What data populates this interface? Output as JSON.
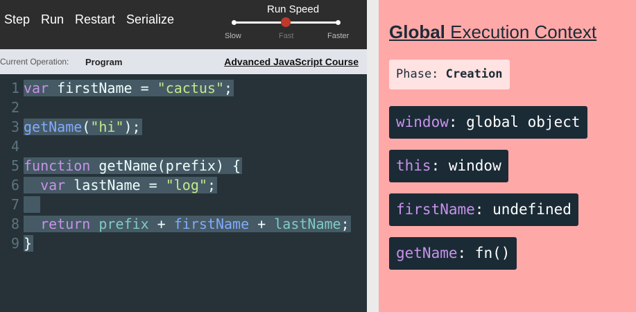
{
  "toolbar": {
    "buttons": [
      "Step",
      "Run",
      "Restart",
      "Serialize"
    ],
    "speed_title": "Run Speed",
    "speed_options": [
      "Slow",
      "Fast",
      "Faster"
    ],
    "speed_selected": "Fast"
  },
  "opbar": {
    "label": "Current Operation:",
    "value": "Program",
    "course_link": "Advanced JavaScript Course"
  },
  "code": {
    "line_numbers": [
      "1",
      "2",
      "3",
      "4",
      "5",
      "6",
      "7",
      "8",
      "9"
    ],
    "lines": [
      [
        {
          "t": "var",
          "c": "kw"
        },
        {
          "t": " firstName = ",
          "c": "plain"
        },
        {
          "t": "\"cactus\"",
          "c": "str"
        },
        {
          "t": ";",
          "c": "plain"
        }
      ],
      [],
      [
        {
          "t": "getName",
          "c": "fn"
        },
        {
          "t": "(",
          "c": "plain"
        },
        {
          "t": "\"hi\"",
          "c": "str"
        },
        {
          "t": ");",
          "c": "plain"
        }
      ],
      [],
      [
        {
          "t": "function",
          "c": "kw"
        },
        {
          "t": " getName(prefix) {",
          "c": "plain"
        }
      ],
      [
        {
          "t": "  ",
          "c": "plain"
        },
        {
          "t": "var",
          "c": "kw"
        },
        {
          "t": " lastName = ",
          "c": "plain"
        },
        {
          "t": "\"log\"",
          "c": "str"
        },
        {
          "t": ";",
          "c": "plain"
        }
      ],
      [
        {
          "t": " ",
          "c": "blank"
        }
      ],
      [
        {
          "t": "  ",
          "c": "plain"
        },
        {
          "t": "return",
          "c": "kw"
        },
        {
          "t": " ",
          "c": "plain"
        },
        {
          "t": "prefix",
          "c": "var"
        },
        {
          "t": " + ",
          "c": "plain"
        },
        {
          "t": "firstName",
          "c": "fn"
        },
        {
          "t": " + ",
          "c": "plain"
        },
        {
          "t": "lastName",
          "c": "var"
        },
        {
          "t": ";",
          "c": "plain"
        }
      ],
      [
        {
          "t": "}",
          "c": "plain"
        }
      ]
    ]
  },
  "context": {
    "title_strong": "Global",
    "title_rest": " Execution Context",
    "phase_label": "Phase: ",
    "phase_value": "Creation",
    "variables": [
      {
        "key": "window",
        "value": ": global object"
      },
      {
        "key": "this",
        "value": ": window"
      },
      {
        "key": "firstName",
        "value": ": undefined"
      },
      {
        "key": "getName",
        "value": ": fn()"
      }
    ]
  },
  "colors": {
    "editor_bg": "#263238",
    "toolbar_bg": "#2d2d2d",
    "context_bg": "#ffa8a8",
    "var_box_bg": "#1b2b36",
    "slider_knob": "#c0392b"
  }
}
